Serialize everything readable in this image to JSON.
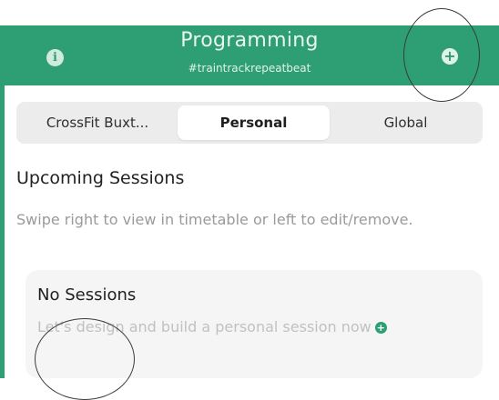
{
  "header": {
    "title": "Programming",
    "subtitle": "#traintrackrepeatbeat",
    "info_icon": "info-icon",
    "add_icon": "plus-circle-icon",
    "accent_color": "#2e9e74"
  },
  "tabs": [
    {
      "label": "CrossFit Buxt...",
      "selected": false
    },
    {
      "label": "Personal",
      "selected": true
    },
    {
      "label": "Global",
      "selected": false
    }
  ],
  "upcoming": {
    "title": "Upcoming Sessions",
    "description": "Swipe right to view in timetable or left to edit/remove."
  },
  "empty_state": {
    "title": "No Sessions",
    "message": "Let's design and build a personal session now",
    "add_icon": "plus-circle-icon"
  }
}
